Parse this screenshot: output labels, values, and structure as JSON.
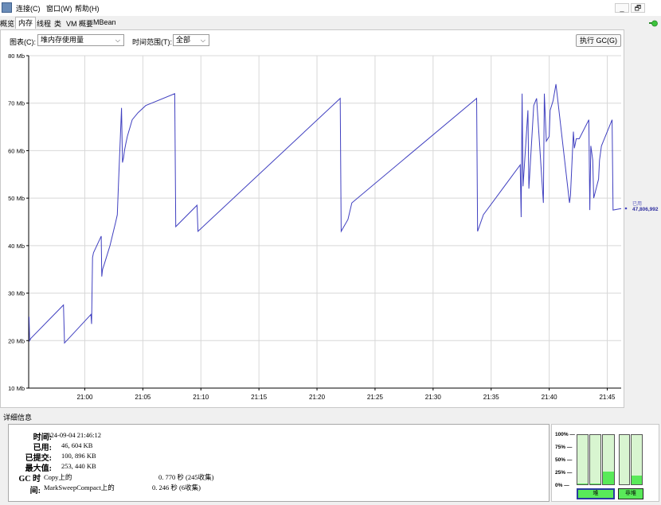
{
  "menu": {
    "connect": "连接(C)",
    "window": "窗口(W)",
    "help": "帮助(H)",
    "minimize": "_",
    "restore": "🗗"
  },
  "tabs": [
    "概览",
    "内存",
    "线程",
    "类",
    "VM 概要",
    "MBean"
  ],
  "active_tab": 1,
  "toolbar": {
    "chart_label": "图表(C):",
    "chart_value": "堆内存使用量",
    "range_label": "时间范围(T):",
    "range_value": "全部",
    "gc_button": "执行 GC(G)"
  },
  "colors": {
    "line": "#4040c0",
    "heap_fill": "#59ea59",
    "heap_bg": "#d8f5d0"
  },
  "chart_data": {
    "type": "line",
    "ylim": [
      10,
      80
    ],
    "yticks": [
      10,
      20,
      30,
      40,
      50,
      60,
      70,
      80
    ],
    "y_tick_labels": [
      "10 Mb",
      "20 Mb",
      "30 Mb",
      "40 Mb",
      "50 Mb",
      "60 Mb",
      "70 Mb",
      "80 Mb"
    ],
    "xlim": [
      "20:55:10",
      "21:46:12"
    ],
    "x_tick_values": [
      "21:00",
      "21:05",
      "21:10",
      "21:15",
      "21:20",
      "21:25",
      "21:30",
      "21:35",
      "21:40",
      "21:45"
    ],
    "x_tick_labels": [
      "21:00",
      "21:05",
      "21:10",
      "21:15",
      "21:20",
      "21:25",
      "21:30",
      "21:35",
      "21:40",
      "21:45"
    ],
    "grid": true,
    "legend": {
      "name": "已用",
      "value": "47,806,992"
    },
    "series": [
      {
        "name": "已用",
        "x": [
          "20:55:12",
          "20:55:15",
          "20:55:22",
          "20:58:10",
          "20:58:15",
          "21:00:32",
          "21:00:35",
          "21:00:40",
          "21:00:45",
          "21:01:25",
          "21:01:28",
          "21:01:32",
          "21:01:40",
          "21:02:10",
          "21:02:40",
          "21:02:48",
          "21:02:55",
          "21:03:10",
          "21:03:15",
          "21:03:20",
          "21:03:25",
          "21:03:32",
          "21:03:40",
          "21:04:05",
          "21:04:35",
          "21:05:15",
          "21:07:45",
          "21:07:50",
          "21:09:40",
          "21:09:45",
          "21:22:00",
          "21:22:05",
          "21:22:40",
          "21:23:00",
          "21:33:45",
          "21:33:50",
          "21:34:20",
          "21:37:30",
          "21:37:35",
          "21:37:40",
          "21:37:45",
          "21:38:10",
          "21:38:15",
          "21:38:40",
          "21:38:55",
          "21:39:30",
          "21:39:35",
          "21:39:45",
          "21:40:00",
          "21:40:05",
          "21:40:20",
          "21:40:35",
          "21:41:45",
          "21:41:50",
          "21:42:05",
          "21:42:10",
          "21:42:20",
          "21:42:35",
          "21:43:25",
          "21:43:30",
          "21:43:35",
          "21:43:45",
          "21:43:50",
          "21:44:15",
          "21:44:20",
          "21:44:30",
          "21:45:25",
          "21:45:30",
          "21:46:12"
        ],
        "y": [
          25.0,
          20.0,
          20.5,
          27.5,
          19.5,
          25.5,
          23.5,
          37.5,
          38.5,
          42.0,
          33.5,
          35.0,
          36.0,
          40.0,
          45.0,
          46.5,
          54.0,
          69.0,
          57.5,
          58.5,
          60.0,
          61.5,
          63.0,
          66.5,
          68.0,
          69.5,
          72.0,
          44.0,
          48.5,
          43.0,
          71.0,
          43.0,
          45.5,
          49.0,
          71.0,
          43.0,
          46.5,
          57.0,
          46.0,
          72.0,
          52.5,
          68.5,
          52.0,
          69.5,
          71.0,
          49.0,
          72.0,
          62.0,
          63.0,
          68.5,
          70.5,
          74.0,
          49.0,
          50.5,
          64.0,
          60.5,
          62.5,
          62.5,
          66.5,
          47.5,
          61.0,
          58.0,
          50.0,
          54.0,
          58.0,
          61.0,
          66.5,
          47.5,
          47.8
        ]
      }
    ]
  },
  "details": {
    "title": "详细信息",
    "time_label": "时间:",
    "time_value": "2024-09-04 21:46:12",
    "used_label": "已用:",
    "used_value": "46, 604 KB",
    "committed_label": "已提交:",
    "committed_value": "100, 896 KB",
    "max_label": "最大值:",
    "max_value": "253, 440 KB",
    "gc_label": "GC 时间:",
    "gc1_name": "Copy上的",
    "gc1_value": "0. 770 秒 (245收集)",
    "gc2_name": "MarkSweepCompact上的",
    "gc2_value": "0. 246 秒 (6收集)"
  },
  "heap_panel": {
    "pct_labels": [
      "100% —",
      "75% —",
      "50% —",
      "25% —",
      "0% —"
    ],
    "bars": [
      {
        "name": "heap-bar-1",
        "fill": 0.02
      },
      {
        "name": "heap-bar-2",
        "fill": 0.02
      },
      {
        "name": "heap-bar-3",
        "fill": 0.26
      },
      {
        "name": "nonheap-bar-1",
        "fill": 0.0
      },
      {
        "name": "nonheap-bar-2",
        "fill": 0.18
      }
    ],
    "heap_button": "堆",
    "nonheap_button": "非堆"
  }
}
